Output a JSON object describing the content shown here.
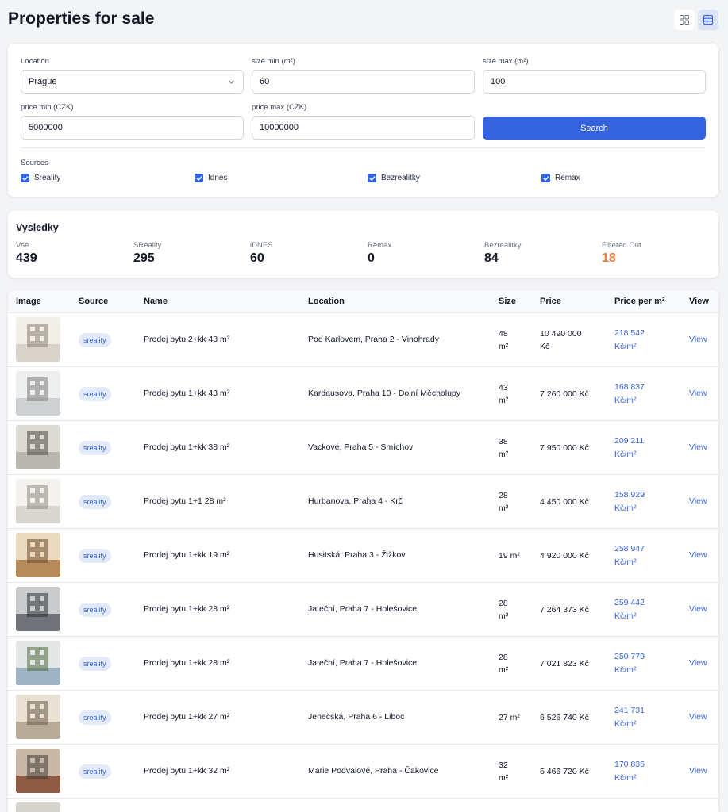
{
  "header": {
    "title": "Properties for sale",
    "grid_icon": "grid-view-icon",
    "table_icon": "table-view-icon",
    "active_view": "table"
  },
  "filters": {
    "location_label": "Location",
    "location_value": "Prague",
    "size_min_label": "size min (m²)",
    "size_min_value": "60",
    "size_max_label": "size max (m²)",
    "size_max_value": "100",
    "price_min_label": "price min (CZK)",
    "price_min_value": "5000000",
    "price_max_label": "price max (CZK)",
    "price_max_value": "10000000",
    "search_label": "Search",
    "sources_label": "Sources",
    "sources": [
      {
        "label": "Sreality",
        "checked": true
      },
      {
        "label": "Idnes",
        "checked": true
      },
      {
        "label": "Bezrealitky",
        "checked": true
      },
      {
        "label": "Remax",
        "checked": true
      }
    ]
  },
  "results": {
    "title": "Vysledky",
    "stats": [
      {
        "label": "Vse",
        "value": "439"
      },
      {
        "label": "SReality",
        "value": "295"
      },
      {
        "label": "iDNES",
        "value": "60"
      },
      {
        "label": "Remax",
        "value": "0"
      },
      {
        "label": "Bezrealitky",
        "value": "84"
      },
      {
        "label": "Filtered Out",
        "value": "18",
        "color": "#ea7a37"
      }
    ]
  },
  "table": {
    "columns": [
      "Image",
      "Source",
      "Name",
      "Location",
      "Size",
      "Price",
      "Price per m²",
      "View"
    ],
    "rows": [
      {
        "source": "sreality",
        "name": "Prodej bytu 2+kk 48 m²",
        "location": "Pod Karlovem, Praha 2 - Vinohrady",
        "size_num": "48",
        "size_unit": "m²",
        "price_a": "10 490 000",
        "price_b": "Kč",
        "ppm_a": "218 542",
        "ppm_b": "Kč/m²",
        "view": "View"
      },
      {
        "source": "sreality",
        "name": "Prodej bytu 1+kk 43 m²",
        "location": "Kardausova, Praha 10 - Dolní Měcholupy",
        "size_num": "43",
        "size_unit": "m²",
        "price_a": "7 260 000 Kč",
        "price_b": "",
        "ppm_a": "168 837",
        "ppm_b": "Kč/m²",
        "view": "View"
      },
      {
        "source": "sreality",
        "name": "Prodej bytu 1+kk 38 m²",
        "location": "Vackové, Praha 5 - Smíchov",
        "size_num": "38",
        "size_unit": "m²",
        "price_a": "7 950 000 Kč",
        "price_b": "",
        "ppm_a": "209 211",
        "ppm_b": "Kč/m²",
        "view": "View"
      },
      {
        "source": "sreality",
        "name": "Prodej bytu 1+1 28 m²",
        "location": "Hurbanova, Praha 4 - Krč",
        "size_num": "28",
        "size_unit": "m²",
        "price_a": "4 450 000 Kč",
        "price_b": "",
        "ppm_a": "158 929",
        "ppm_b": "Kč/m²",
        "view": "View"
      },
      {
        "source": "sreality",
        "name": "Prodej bytu 1+kk 19 m²",
        "location": "Husitská, Praha 3 - Žižkov",
        "size_num": "19 m²",
        "size_unit": "",
        "price_a": "4 920 000 Kč",
        "price_b": "",
        "ppm_a": "258 947",
        "ppm_b": "Kč/m²",
        "view": "View"
      },
      {
        "source": "sreality",
        "name": "Prodej bytu 1+kk 28 m²",
        "location": "Jateční, Praha 7 - Holešovice",
        "size_num": "28",
        "size_unit": "m²",
        "price_a": "7 264 373 Kč",
        "price_b": "",
        "ppm_a": "259 442",
        "ppm_b": "Kč/m²",
        "view": "View"
      },
      {
        "source": "sreality",
        "name": "Prodej bytu 1+kk 28 m²",
        "location": "Jateční, Praha 7 - Holešovice",
        "size_num": "28",
        "size_unit": "m²",
        "price_a": "7 021 823 Kč",
        "price_b": "",
        "ppm_a": "250 779",
        "ppm_b": "Kč/m²",
        "view": "View"
      },
      {
        "source": "sreality",
        "name": "Prodej bytu 1+kk 27 m²",
        "location": "Jenečská, Praha 6 - Liboc",
        "size_num": "27 m²",
        "size_unit": "",
        "price_a": "6 526 740 Kč",
        "price_b": "",
        "ppm_a": "241 731",
        "ppm_b": "Kč/m²",
        "view": "View"
      },
      {
        "source": "sreality",
        "name": "Prodej bytu 1+kk 32 m²",
        "location": "Marie Podvalové, Praha - Čakovice",
        "size_num": "32",
        "size_unit": "m²",
        "price_a": "5 466 720 Kč",
        "price_b": "",
        "ppm_a": "170 835",
        "ppm_b": "Kč/m²",
        "view": "View"
      }
    ]
  },
  "colors": {
    "accent": "#3563e0",
    "badge_bg": "#e3eaf9",
    "filtered_out": "#ea7a37"
  }
}
